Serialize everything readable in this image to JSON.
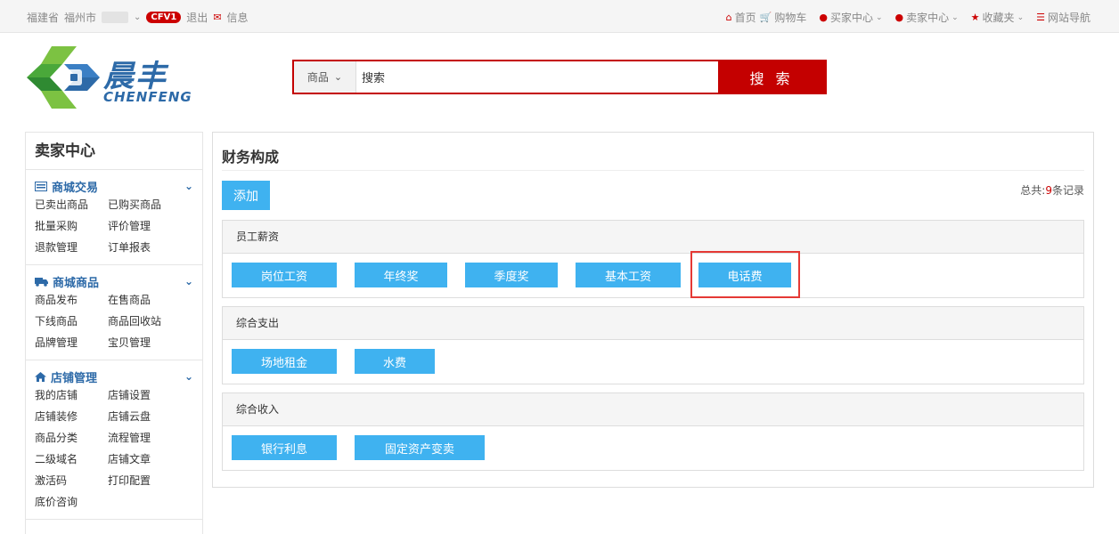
{
  "topbar": {
    "province": "福建省",
    "city": "福州市",
    "badge": "CFV1",
    "logout": "退出",
    "message": "信息",
    "home": "首页",
    "cart": "购物车",
    "buyer_center": "买家中心",
    "seller_center": "卖家中心",
    "favorites": "收藏夹",
    "site_nav": "网站导航"
  },
  "logo": {
    "cn": "晨丰",
    "en": "CHENFENG"
  },
  "search": {
    "category": "商品",
    "value": "搜索",
    "button": "搜 索"
  },
  "sidebar": {
    "title": "卖家中心",
    "sections": [
      {
        "title": "商城交易",
        "icon": "list-icon",
        "items": [
          "已卖出商品",
          "已购买商品",
          "批量采购",
          "评价管理",
          "退款管理",
          "订单报表"
        ]
      },
      {
        "title": "商城商品",
        "icon": "truck-icon",
        "items": [
          "商品发布",
          "在售商品",
          "下线商品",
          "商品回收站",
          "品牌管理",
          "宝贝管理"
        ]
      },
      {
        "title": "店铺管理",
        "icon": "home-icon",
        "items": [
          "我的店铺",
          "店铺设置",
          "店铺装修",
          "店铺云盘",
          "商品分类",
          "流程管理",
          "二级域名",
          "店铺文章",
          "激活码",
          "打印配置",
          "底价咨询"
        ]
      }
    ]
  },
  "main": {
    "title": "财务构成",
    "add_button": "添加",
    "total_prefix": "总共:",
    "total_count": "9",
    "total_suffix": "条记录",
    "groups": [
      {
        "title": "员工薪资",
        "tags": [
          "岗位工资",
          "年终奖",
          "季度奖",
          "基本工资",
          "电话费"
        ]
      },
      {
        "title": "综合支出",
        "tags": [
          "场地租金",
          "水费"
        ]
      },
      {
        "title": "综合收入",
        "tags": [
          "银行利息",
          "固定资产变卖"
        ]
      }
    ]
  },
  "colors": {
    "accent_red": "#c40000",
    "tag_blue": "#3fb2f0",
    "link_blue": "#2d6aa8",
    "highlight": "#e53935"
  }
}
